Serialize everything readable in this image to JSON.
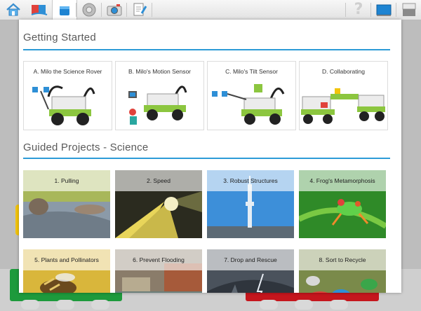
{
  "toolbar": {
    "home_icon": "home-icon",
    "lobby_icon": "lobby-book-icon",
    "selected_icon": "project-cube-icon",
    "brick_icon": "brick-wheel-icon",
    "camera_icon": "camera-icon",
    "docs_icon": "document-pen-icon",
    "help_glyph": "?",
    "screen_icon": "screen-icon",
    "window_icon": "window-icon"
  },
  "getting_started": {
    "title": "Getting Started",
    "cards": [
      {
        "label": "A. Milo the Science Rover"
      },
      {
        "label": "B. Milo's Motion Sensor"
      },
      {
        "label": "C. Milo's Tilt Sensor"
      },
      {
        "label": "D. Collaborating"
      }
    ]
  },
  "guided_projects": {
    "title": "Guided Projects - Science",
    "projects": [
      {
        "label": "1. Pulling"
      },
      {
        "label": "2. Speed"
      },
      {
        "label": "3. Robust Structures"
      },
      {
        "label": "4. Frog's Metamorphosis"
      },
      {
        "label": "5. Plants and Pollinators"
      },
      {
        "label": "6. Prevent Flooding"
      },
      {
        "label": "7. Drop and Rescue"
      },
      {
        "label": "8. Sort to Recycle"
      }
    ]
  },
  "colors": {
    "accent_blue": "#2d9bd7",
    "block_green": "#1d9a3c",
    "block_red": "#c5161d"
  }
}
